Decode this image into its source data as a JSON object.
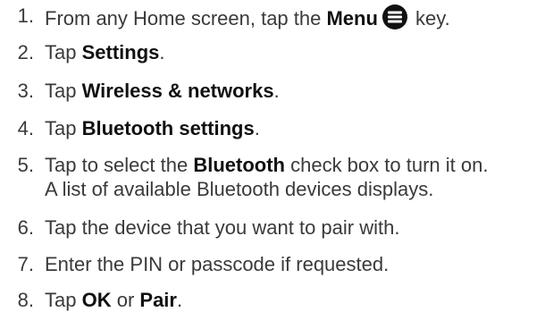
{
  "steps": [
    {
      "num": "1.",
      "pre": "From any Home screen, tap the ",
      "bold": "Menu",
      "post": " key.",
      "icon": "menu-key-icon"
    },
    {
      "num": "2.",
      "pre": "Tap ",
      "bold": "Settings",
      "post": "."
    },
    {
      "num": "3.",
      "pre": "Tap ",
      "bold": "Wireless & networks",
      "post": "."
    },
    {
      "num": "4.",
      "pre": "Tap ",
      "bold": "Bluetooth settings",
      "post": "."
    },
    {
      "num": "5.",
      "pre": "Tap to select the ",
      "bold": "Bluetooth",
      "post": " check box to turn it on.",
      "line2": "A list of available Bluetooth devices displays."
    },
    {
      "num": "6.",
      "text": "Tap the device that you want to pair with."
    },
    {
      "num": "7.",
      "text": "Enter the PIN or passcode if requested."
    },
    {
      "num": "8.",
      "pre": "Tap ",
      "bold": "OK",
      "mid": " or ",
      "bold2": "Pair",
      "post": "."
    }
  ]
}
